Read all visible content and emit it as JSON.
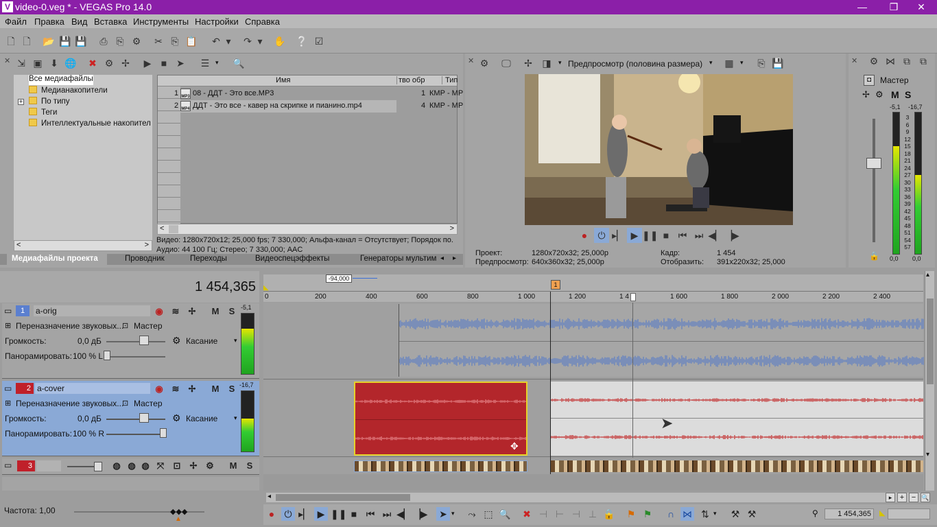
{
  "window": {
    "title": "video-0.veg * - VEGAS Pro 14.0",
    "min": "—",
    "max": "❒",
    "close": "✕"
  },
  "menu": [
    "Файл",
    "Правка",
    "Вид",
    "Вставка",
    "Инструменты",
    "Настройки",
    "Справка"
  ],
  "explorer": {
    "tree": [
      "Все медиафайлы",
      "Медианакопители",
      "По типу",
      "Теги",
      "Интеллектуальные накопител"
    ],
    "col_name": "Имя",
    "col_proc": "тво обр",
    "col_type": "Тип",
    "rows": [
      {
        "n": "1",
        "badge": "MP3",
        "name": "08 - ДДТ - Это все.MP3",
        "cnt": "1",
        "type": "КМР - МР"
      },
      {
        "n": "2",
        "badge": "MP4",
        "name": "ДДТ - Это все - кавер на скрипке и пианино.mp4",
        "cnt": "4",
        "type": "КМР - МР"
      }
    ],
    "info_video": "Видео: 1280x720x12; 25,000 fps; 7 330,000; Альфа-канал = Отсутствует; Порядок по.",
    "info_audio": "Аудио: 44 100 Гц; Стерео; 7 330,000; AAC",
    "tabs": [
      "Медиафайлы проекта",
      "Проводник",
      "Переходы",
      "Видеоспецэффекты",
      "Генераторы мультим"
    ]
  },
  "preview": {
    "mode": "Предпросмотр (половина размера)",
    "project_label": "Проект:",
    "project_val": "1280x720x32; 25,000p",
    "preview_label": "Предпросмотр:",
    "preview_val": "640x360x32; 25,000p",
    "frame_label": "Кадр:",
    "frame_val": "1 454",
    "display_label": "Отобразить:",
    "display_val": "391x220x32; 25,000"
  },
  "master": {
    "title": "Мастер",
    "m": "M",
    "s": "S",
    "peak_l": "-5,1",
    "peak_r": "-16,7",
    "scale": [
      "3",
      "6",
      "9",
      "12",
      "15",
      "18",
      "21",
      "24",
      "27",
      "30",
      "33",
      "36",
      "39",
      "42",
      "45",
      "48",
      "51",
      "54",
      "57"
    ],
    "bottom_l": "0,0",
    "bottom_r": "0,0",
    "level_l": 0.76,
    "level_r": 0.56
  },
  "timeline": {
    "counter": "1 454,365",
    "offset": "-94,000",
    "marker": "1",
    "ticks": [
      "0",
      "200",
      "400",
      "600",
      "800",
      "1 000",
      "1 200",
      "1 4",
      "1 600",
      "1 800",
      "2 000",
      "2 200",
      "2 400"
    ],
    "rate": "Частота: 1,00",
    "status_time": "1 454,365"
  },
  "tracks": [
    {
      "num": "1",
      "name": "a-orig",
      "peak": "-5,1",
      "reassign": "Переназначение звуковых...",
      "bus": "Мастер",
      "vol_label": "Громкость:",
      "vol": "0,0 дБ",
      "touch": "Касание",
      "pan_label": "Панорамировать:",
      "pan": "100 % L",
      "level": 0.75
    },
    {
      "num": "2",
      "name": "a-cover",
      "peak": "-16,7",
      "reassign": "Переназначение звуковых...",
      "bus": "Мастер",
      "vol_label": "Громкость:",
      "vol": "0,0 дБ",
      "touch": "Касание",
      "pan_label": "Панорамировать:",
      "pan": "100 % R",
      "level": 0.55
    },
    {
      "num": "3"
    }
  ],
  "ms": {
    "m": "M",
    "s": "S"
  },
  "colors": {
    "title": "#8b1fa8",
    "track2": "#8aa9d6",
    "clip_red": "#b3262b",
    "wave_blue": "#5d7fc4"
  }
}
